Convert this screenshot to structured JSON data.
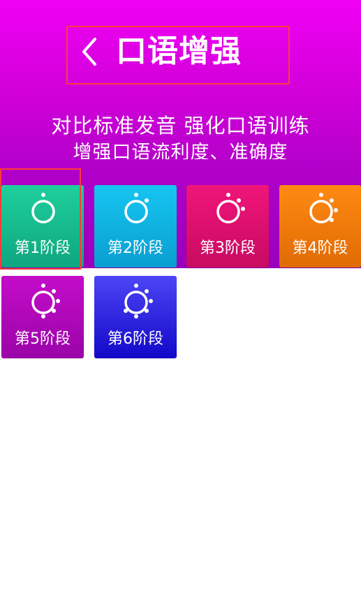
{
  "header": {
    "title": "口语增强",
    "back_icon": "chevron-left-icon"
  },
  "intro": {
    "line1": "对比标准发音  强化口语训练",
    "line2": "增强口语流利度、准确度"
  },
  "colors": {
    "hero_top": "#f000f4",
    "hero_bottom": "#9a00be",
    "highlight": "#ff3b3b"
  },
  "stages": [
    {
      "label": "第1阶段",
      "icon": "stage-ring-icon",
      "color_top": "#1fcf9c",
      "color_bottom": "#0fa67f"
    },
    {
      "label": "第2阶段",
      "icon": "stage-ring-icon",
      "color_top": "#16c5f1",
      "color_bottom": "#0a9ed1"
    },
    {
      "label": "第3阶段",
      "icon": "stage-ring-icon",
      "color_top": "#f0157a",
      "color_bottom": "#c80b62"
    },
    {
      "label": "第4阶段",
      "icon": "stage-ring-icon",
      "color_top": "#ff8a12",
      "color_bottom": "#e06b05"
    },
    {
      "label": "第5阶段",
      "icon": "stage-ring-icon",
      "color_top": "#c40cc9",
      "color_bottom": "#9a04a8"
    },
    {
      "label": "第6阶段",
      "icon": "stage-ring-icon",
      "color_top": "#4d45f5",
      "color_bottom": "#1208c9"
    }
  ]
}
